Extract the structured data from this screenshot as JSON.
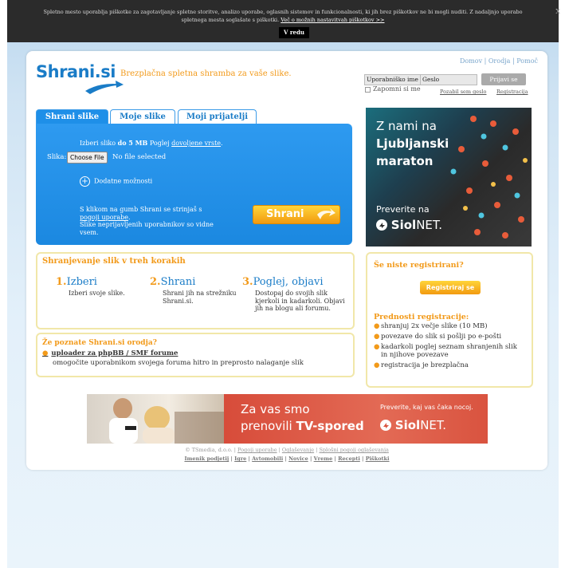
{
  "cookie": {
    "text": "Spletno mesto uporablja piškotke za zagotavljanje spletne storitve, analizo uporabe, oglasnih sistemov in funkcionalnosti, ki jih brez piškotkov ne bi mogli nuditi. Z nadaljnjo uporabo spletnega mesta soglašate s piškotki.",
    "more_link": "Več o možnih nastavitvah piškotkov >>",
    "ok_button": "V redu",
    "close": "X"
  },
  "header": {
    "logo": "Shrani.si",
    "tagline": "Brezplačna spletna shramba za vaše slike.",
    "toplinks": [
      "Domov",
      "Orodja",
      "Pomoč"
    ]
  },
  "login": {
    "username_value": "Uporabniško ime",
    "password_value": "Geslo",
    "button": "Prijavi se",
    "remember": "Zapomni si me",
    "forgot": "Pozabil sem geslo",
    "register": "Registracija"
  },
  "tabs": [
    "Shrani slike",
    "Moje slike",
    "Moji prijatelji"
  ],
  "upload": {
    "hint_pre": "Izberi sliko",
    "hint_bold": "do 5 MB",
    "hint_mid": "Poglej",
    "hint_link": "dovoljene vrste",
    "file_label": "Slika:",
    "file_button": "Choose File",
    "file_status": "No file selected",
    "more_options": "Dodatne možnosti",
    "terms_pre": "S klikom na gumb Shrani se strinjaš s",
    "terms_link": "pogoji uporabe",
    "terms_post": "Slike neprijavljenih uporabnikov so vidne vsem.",
    "save_button": "Shrani"
  },
  "steps": {
    "title": "Shranjevanje slik v treh korakih",
    "items": [
      {
        "num": "1.",
        "head": "Izberi",
        "text": "Izberi svoje slike."
      },
      {
        "num": "2.",
        "head": "Shrani",
        "text": "Shrani jih na strežniku Shrani.si."
      },
      {
        "num": "3.",
        "head": "Poglej, objavi",
        "text": "Dostopaj do svojih slik kjerkoli in kadarkoli. Objavi jih na blogu ali forumu."
      }
    ]
  },
  "tools": {
    "title": "Že poznate Shrani.si orodja?",
    "link": "uploader za phpBB / SMF forume",
    "desc": "omogočite uporabnikom svojega foruma hitro in preprosto nalaganje slik"
  },
  "ad_right": {
    "line1": "Z nami na",
    "line2": "Ljubljanski",
    "line3": "maraton",
    "line4": "Preverite na",
    "brand_bold": "Siol",
    "brand_rest": "NET."
  },
  "register": {
    "title": "Še niste registrirani?",
    "button": "Registriraj se",
    "adv_title": "Prednosti registracije:",
    "advantages": [
      "shranjuj 2x večje slike (10 MB)",
      "povezave do slik si pošlji po e-pošti",
      "kadarkoli poglej seznam shranjenih slik in njihove povezave",
      "registracija je brezplačna"
    ]
  },
  "banner": {
    "line1": "Za vas smo",
    "line2_pre": "prenovili",
    "line2_bold": "TV-spored",
    "line3": "Preverite, kaj vas čaka nocoj.",
    "brand_bold": "Siol",
    "brand_rest": "NET."
  },
  "footer": {
    "copyright": "© TSmedia, d.o.o.",
    "links1": [
      "Pogoji uporabe",
      "Oglaševanje",
      "Splošni pogoji oglaševanja"
    ],
    "links2": [
      "Imenik podjetij",
      "Igre",
      "Avtomobili",
      "Novice",
      "Vreme",
      "Recepti",
      "Piškotki"
    ]
  },
  "colors": {
    "brand_blue": "#1a7cc7",
    "accent_orange": "#f29a1a",
    "panel_blue": "#1e8fe8",
    "box_border": "#f1e7a9"
  }
}
